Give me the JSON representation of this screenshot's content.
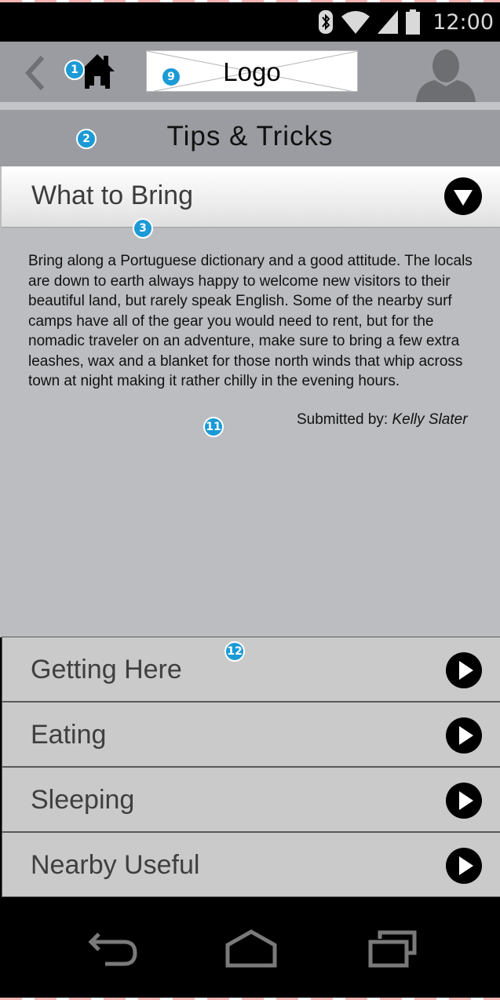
{
  "status_bar": {
    "time": "12:00",
    "icons": [
      "bluetooth-icon",
      "wifi-icon",
      "signal-icon",
      "battery-icon"
    ]
  },
  "header": {
    "logo_text": "Logo",
    "icons": [
      "back-chevron-icon",
      "home-icon",
      "avatar-icon"
    ]
  },
  "page": {
    "title": "Tips & Tricks"
  },
  "expanded_section": {
    "label": "What to Bring",
    "body": "Bring along a Portuguese  dictionary and a good attitude. The locals are down to earth always happy to welcome new visitors to their beautiful land, but rarely speak English. Some of the nearby surf camps have all of the gear you would need to rent, but for the nomadic traveler on an adventure, make sure to  bring a few extra leashes, wax and a blanket for those north winds that whip across town at night making it rather chilly in the evening hours.",
    "submitted_prefix": "Submitted by: ",
    "submitted_name": "Kelly Slater"
  },
  "sections": [
    {
      "label": "Getting Here"
    },
    {
      "label": "Eating"
    },
    {
      "label": "Sleeping"
    },
    {
      "label": "Nearby Useful"
    }
  ],
  "annotations": {
    "a1": "1",
    "a2": "2",
    "a3": "3",
    "a9": "9",
    "a11": "11",
    "a12": "12"
  },
  "nav_bar": {
    "icons": [
      "back-nav-icon",
      "home-nav-icon",
      "recent-apps-icon"
    ]
  },
  "colors": {
    "header_bg": "#9b9ca1",
    "content_bg": "#bcbdc1",
    "item_bg": "#cacaca",
    "badge": "#1b9ad6"
  }
}
